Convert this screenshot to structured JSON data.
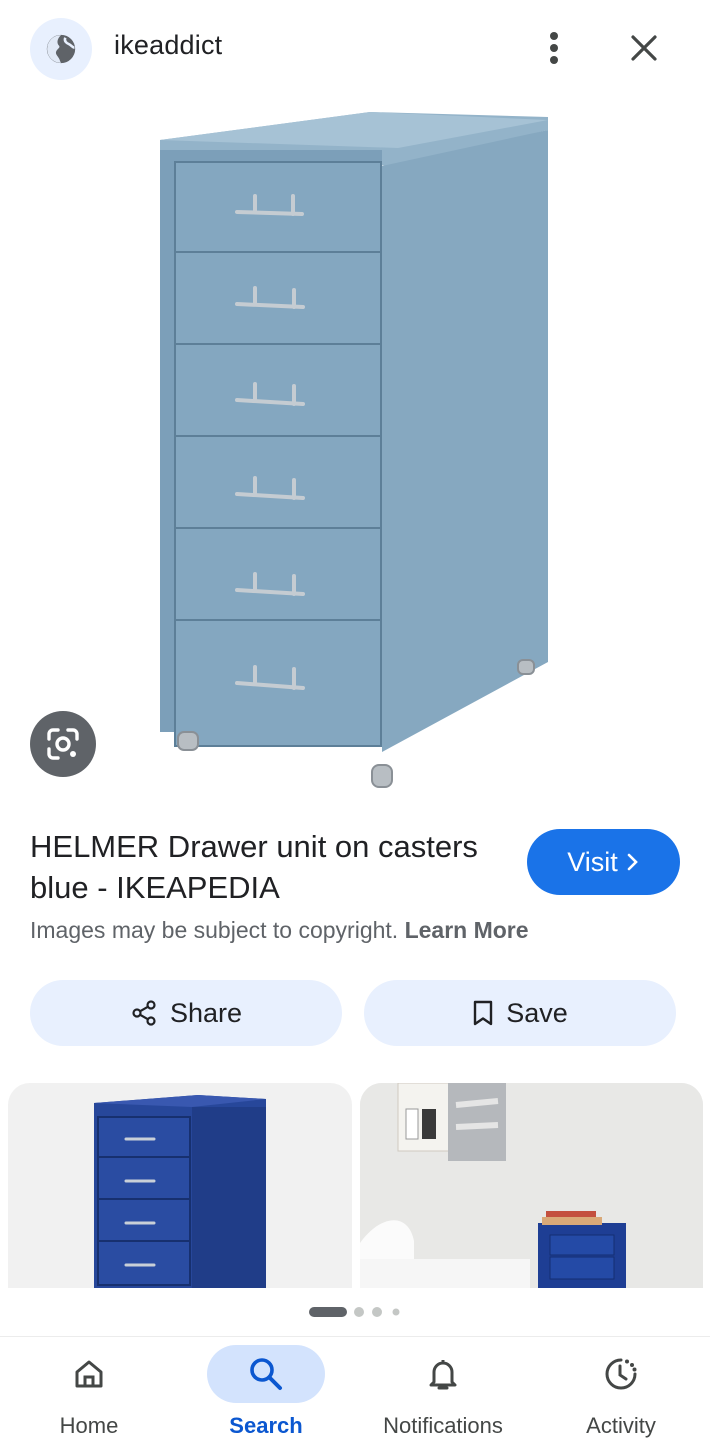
{
  "header": {
    "site_icon": "globe-icon",
    "site_name": "ikeaddict",
    "more_icon": "more-vert-icon",
    "close_icon": "close-icon"
  },
  "main_image": {
    "subject": "HELMER drawer unit, blue",
    "lens_icon": "google-lens-icon"
  },
  "result": {
    "title": "HELMER Drawer unit on casters blue - IKEAPEDIA",
    "visit_label": "Visit",
    "copyright_text": "Images may be subject to copyright.",
    "learn_more": "Learn More"
  },
  "actions": {
    "share_label": "Share",
    "save_label": "Save"
  },
  "related": {
    "items": [
      "dark blue drawer unit",
      "blue drawer unit in room"
    ]
  },
  "pager": {
    "active_index": 0,
    "count": 4
  },
  "bottom_nav": {
    "items": [
      {
        "label": "Home",
        "icon": "home-icon"
      },
      {
        "label": "Search",
        "icon": "search-icon"
      },
      {
        "label": "Notifications",
        "icon": "bell-icon"
      },
      {
        "label": "Activity",
        "icon": "activity-icon"
      }
    ],
    "active": "Search"
  },
  "colors": {
    "accent": "#1a73e8",
    "pill_bg": "#e8f0fe",
    "cabinet": "#7fa3bd"
  }
}
